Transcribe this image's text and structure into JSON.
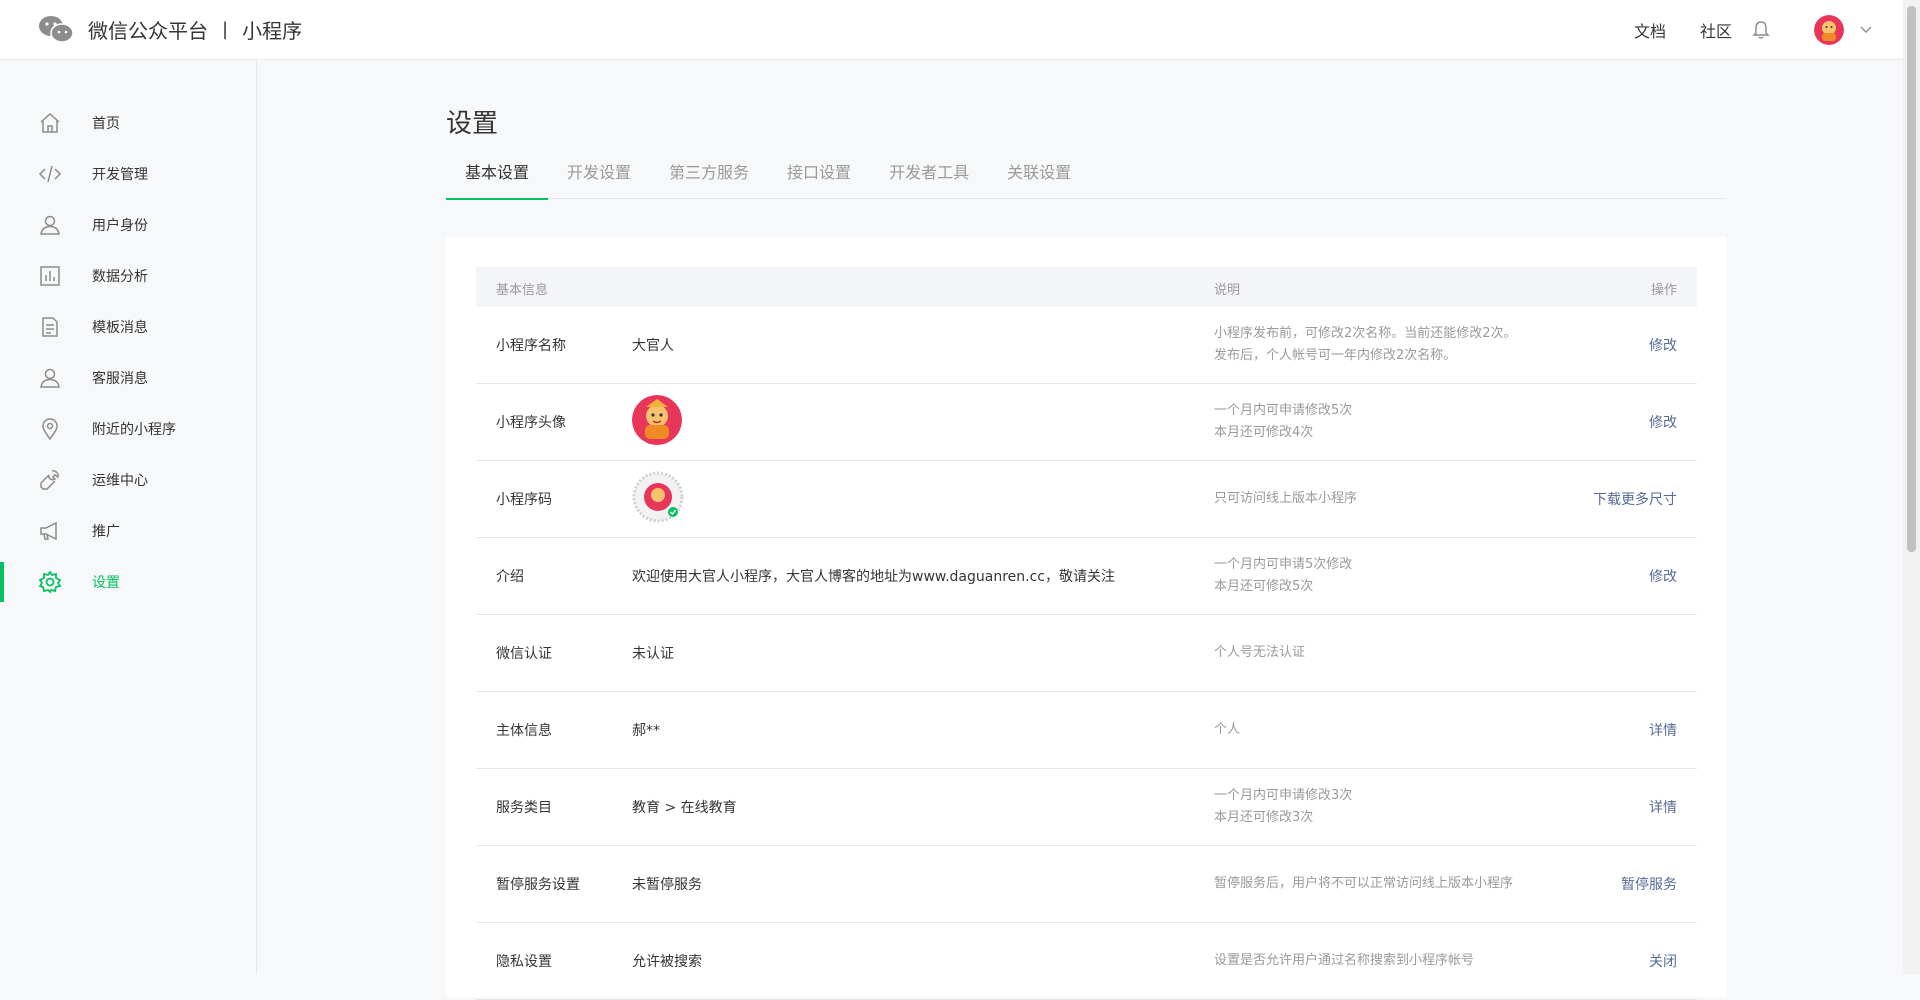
{
  "header": {
    "platform_title": "微信公众平台",
    "separator": "|",
    "subtitle": "小程序",
    "links": [
      "文档",
      "社区"
    ]
  },
  "sidebar": {
    "items": [
      {
        "label": "首页",
        "icon": "home-icon"
      },
      {
        "label": "开发管理",
        "icon": "code-icon"
      },
      {
        "label": "用户身份",
        "icon": "user-icon"
      },
      {
        "label": "数据分析",
        "icon": "chart-icon"
      },
      {
        "label": "模板消息",
        "icon": "document-icon"
      },
      {
        "label": "客服消息",
        "icon": "support-icon"
      },
      {
        "label": "附近的小程序",
        "icon": "location-icon"
      },
      {
        "label": "运维中心",
        "icon": "wrench-icon"
      },
      {
        "label": "推广",
        "icon": "megaphone-icon"
      },
      {
        "label": "设置",
        "icon": "gear-icon",
        "active": true
      }
    ]
  },
  "main": {
    "title": "设置",
    "tabs": [
      {
        "label": "基本设置",
        "active": true
      },
      {
        "label": "开发设置"
      },
      {
        "label": "第三方服务"
      },
      {
        "label": "接口设置"
      },
      {
        "label": "开发者工具"
      },
      {
        "label": "关联设置"
      }
    ],
    "table": {
      "header": {
        "info": "基本信息",
        "desc": "说明",
        "op": "操作"
      },
      "rows": [
        {
          "label": "小程序名称",
          "value": "大官人",
          "desc1": "小程序发布前，可修改2次名称。当前还能修改2次。",
          "desc2": "发布后，个人帐号可一年内修改2次名称。",
          "op": "修改"
        },
        {
          "label": "小程序头像",
          "value": "",
          "desc1": "一个月内可申请修改5次",
          "desc2": "本月还可修改4次",
          "op": "修改"
        },
        {
          "label": "小程序码",
          "value": "",
          "desc1": "只可访问线上版本小程序",
          "desc2": "",
          "op": "下载更多尺寸"
        },
        {
          "label": "介绍",
          "value": "欢迎使用大官人小程序，大官人博客的地址为www.daguanren.cc，敬请关注",
          "desc1": "一个月内可申请5次修改",
          "desc2": "本月还可修改5次",
          "op": "修改"
        },
        {
          "label": "微信认证",
          "value": "未认证",
          "desc1": "个人号无法认证",
          "desc2": "",
          "op": ""
        },
        {
          "label": "主体信息",
          "value": "郝**",
          "desc1": "个人",
          "desc2": "",
          "op": "详情"
        },
        {
          "label": "服务类目",
          "value": "教育 > 在线教育",
          "desc1": "一个月内可申请修改3次",
          "desc2": "本月还可修改3次",
          "op": "详情"
        },
        {
          "label": "暂停服务设置",
          "value": "未暂停服务",
          "desc1": "暂停服务后，用户将不可以正常访问线上版本小程序",
          "desc2": "",
          "op": "暂停服务"
        },
        {
          "label": "隐私设置",
          "value": "允许被搜索",
          "desc1": "设置是否允许用户通过名称搜索到小程序帐号",
          "desc2": "",
          "op": "关闭"
        }
      ]
    }
  },
  "colors": {
    "accent": "#07c160",
    "link": "#576b95",
    "muted": "#9a9a9a"
  }
}
